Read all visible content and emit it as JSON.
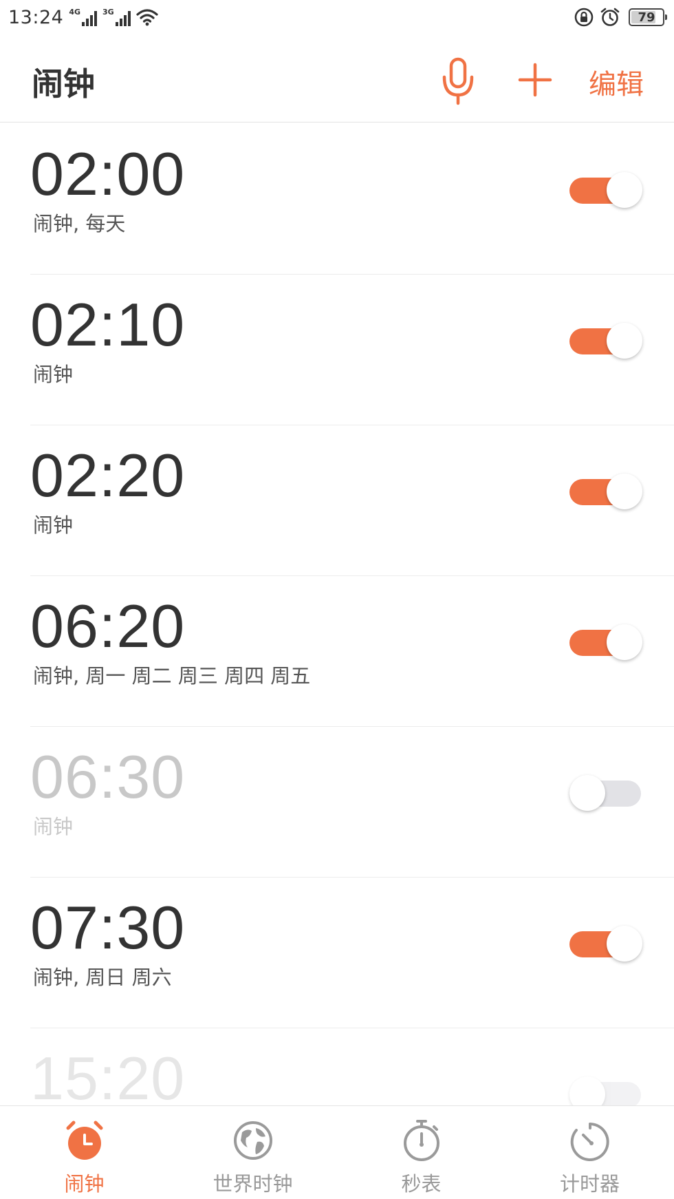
{
  "status_bar": {
    "time": "13:24",
    "network_1": "4G",
    "network_2": "3G",
    "battery": "79",
    "battery_level": 0.79
  },
  "header": {
    "title": "闹钟",
    "edit_label": "编辑"
  },
  "colors": {
    "accent": "#f07244",
    "text_primary": "#333333",
    "text_disabled": "#c8c8c8",
    "toggle_off": "#e2e2e6"
  },
  "alarms": [
    {
      "time": "02:00",
      "label": "闹钟, 每天",
      "enabled": true
    },
    {
      "time": "02:10",
      "label": "闹钟",
      "enabled": true
    },
    {
      "time": "02:20",
      "label": "闹钟",
      "enabled": true
    },
    {
      "time": "06:20",
      "label": "闹钟, 周一 周二 周三 周四 周五",
      "enabled": true
    },
    {
      "time": "06:30",
      "label": "闹钟",
      "enabled": false
    },
    {
      "time": "07:30",
      "label": "闹钟, 周日 周六",
      "enabled": true
    },
    {
      "time": "15:20",
      "label": "",
      "enabled": false
    }
  ],
  "bottom_nav": {
    "items": [
      {
        "label": "闹钟",
        "icon": "alarm-clock-icon",
        "active": true
      },
      {
        "label": "世界时钟",
        "icon": "globe-icon",
        "active": false
      },
      {
        "label": "秒表",
        "icon": "stopwatch-icon",
        "active": false
      },
      {
        "label": "计时器",
        "icon": "timer-icon",
        "active": false
      }
    ]
  }
}
